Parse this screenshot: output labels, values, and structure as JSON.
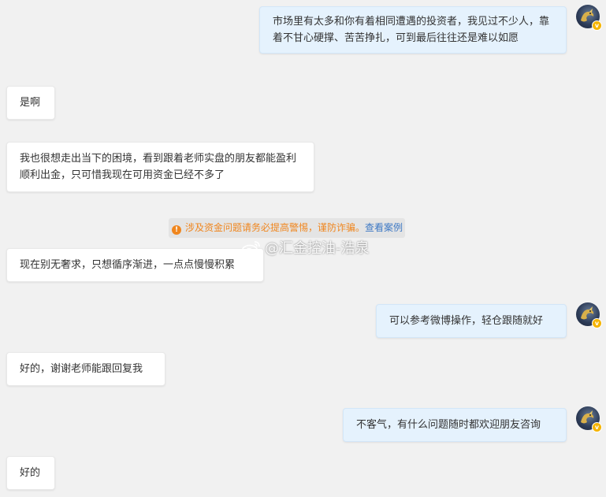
{
  "messages": [
    {
      "side": "out",
      "text": "市场里有太多和你有着相同遭遇的投资者，我见过不少人，靠着不甘心硬撑、苦苦挣扎，可到最后往往还是难以如愿"
    },
    {
      "side": "in",
      "text": "是啊"
    },
    {
      "side": "in",
      "text": "我也很想走出当下的困境，看到跟着老师实盘的朋友都能盈利顺利出金，只可惜我现在可用资金已经不多了"
    },
    {
      "side": "in",
      "text": "现在别无奢求，只想循序渐进，一点点慢慢积累"
    },
    {
      "side": "out",
      "text": "可以参考微博操作，轻仓跟随就好"
    },
    {
      "side": "in",
      "text": "好的，谢谢老师能跟回复我"
    },
    {
      "side": "out",
      "text": "不客气，有什么问题随时都欢迎朋友咨询"
    },
    {
      "side": "in",
      "text": "好的"
    }
  ],
  "notice": {
    "text": "涉及资金问题请务必提高警惕，谨防诈骗。",
    "link": "查看案例"
  },
  "watermark": {
    "text": "@汇金控油-浩泉"
  },
  "avatar": {
    "badge": "v"
  },
  "colors": {
    "background": "#f1f1f1",
    "incoming_bubble": "#ffffff",
    "outgoing_bubble": "#e5f2fd",
    "notice_text": "#f0861e",
    "notice_link": "#3d78c4",
    "verified_badge": "#f5b400"
  }
}
